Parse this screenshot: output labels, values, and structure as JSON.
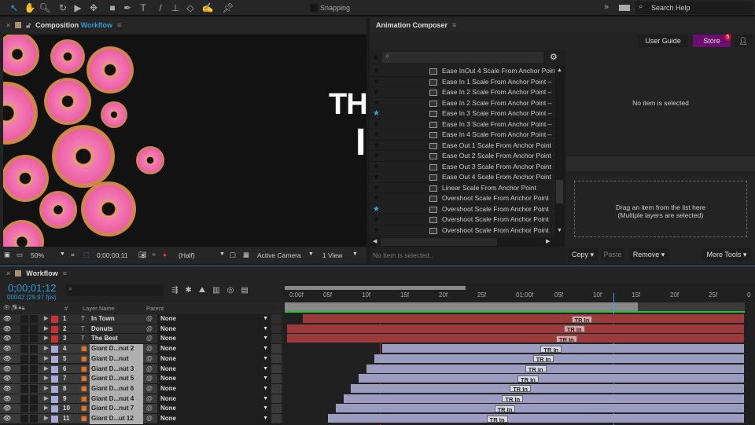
{
  "toolbar": {
    "tools": [
      "selection-tool",
      "hand-tool",
      "zoom-tool",
      "rotate-tool",
      "camera-tool",
      "pan-behind-tool",
      "rectangle-tool",
      "pen-tool",
      "type-tool",
      "brush-tool",
      "clone-stamp-tool",
      "eraser-tool",
      "roto-brush-tool",
      "puppet-pin-tool"
    ],
    "snapping": "Snapping",
    "search_help": "Search Help"
  },
  "composition": {
    "label": "Composition",
    "name": "Workflow",
    "visible_text": [
      "TH",
      "I"
    ],
    "footer": {
      "zoom": "50%",
      "timecode": "0;00;00;11",
      "resolution": "(Half)",
      "camera": "Active Camera",
      "views": "1 View"
    }
  },
  "composer": {
    "title": "Animation Composer",
    "user_guide": "User Guide",
    "store": "Store",
    "store_badge": "5",
    "search_placeholder": "",
    "items": [
      {
        "label": "Ease InOut 4 Scale From Anchor Point",
        "fav": false
      },
      {
        "label": "Ease In 1 Scale From Anchor Point –",
        "fav": false
      },
      {
        "label": "Ease In 2 Scale From Anchor Point –",
        "fav": false
      },
      {
        "label": "Ease In 2 Scale From Anchor Point –",
        "fav": false
      },
      {
        "label": "Ease In 3 Scale From Anchor Point –",
        "fav": true
      },
      {
        "label": "Ease In 3 Scale From Anchor Point –",
        "fav": false
      },
      {
        "label": "Ease In 4 Scale From Anchor Point –",
        "fav": false
      },
      {
        "label": "Ease Out 1 Scale From Anchor Point",
        "fav": false
      },
      {
        "label": "Ease Out 2 Scale From Anchor Point",
        "fav": false
      },
      {
        "label": "Ease Out 3 Scale From Anchor Point",
        "fav": false
      },
      {
        "label": "Ease Out 4 Scale From Anchor Point",
        "fav": false
      },
      {
        "label": "Linear Scale From Anchor Point",
        "fav": false
      },
      {
        "label": "Overshoot Scale From Anchor Point",
        "fav": false
      },
      {
        "label": "Overshoot Scale From Anchor Point",
        "fav": true
      },
      {
        "label": "Overshoot Scale From Anchor Point",
        "fav": false
      },
      {
        "label": "Overshoot Scale From Anchor Point",
        "fav": false
      }
    ],
    "status": "No item is selected..",
    "preview_empty": "No item is selected",
    "drop_line1": "Drag an item from the list here",
    "drop_line2": "(Multiple layers are selected)",
    "copy": "Copy",
    "paste": "Paste",
    "remove": "Remove",
    "more_tools": "More Tools"
  },
  "timeline": {
    "name": "Workflow",
    "timecode": "0;00;01;12",
    "frames": "00042 (29.97 fps)",
    "col_layer": "Layer Name",
    "col_parent": "Parent",
    "col_num": "#",
    "ruler": [
      "0:00f",
      "05f",
      "10f",
      "15f",
      "20f",
      "25f",
      "01:00f",
      "05f",
      "10f",
      "15f",
      "20f",
      "25f",
      "0"
    ],
    "current_frame": 42,
    "work_area_end_frame": 45,
    "layers": [
      {
        "n": "1",
        "name": "In Town",
        "type": "text",
        "color": "#c83232",
        "parent": "None",
        "start": 2,
        "marker": 37,
        "marker_label": "TR In"
      },
      {
        "n": "2",
        "name": "Donuts",
        "type": "text",
        "color": "#c83232",
        "parent": "None",
        "start": 0,
        "marker": 36,
        "marker_label": "TR In"
      },
      {
        "n": "3",
        "name": "The Best",
        "type": "text",
        "color": "#c83232",
        "parent": "None",
        "start": 0,
        "marker": 35,
        "marker_label": "TR In"
      },
      {
        "n": "4",
        "name": "Giant D...nut 2",
        "type": "ai",
        "color": "#a8a8d8",
        "parent": "None",
        "start": 12,
        "marker": 33,
        "marker_label": "TR In"
      },
      {
        "n": "5",
        "name": "Giant D...nut",
        "type": "ai",
        "color": "#a8a8d8",
        "parent": "None",
        "start": 11,
        "marker": 32,
        "marker_label": "TR In"
      },
      {
        "n": "6",
        "name": "Giant D...nut 3",
        "type": "ai",
        "color": "#a8a8d8",
        "parent": "None",
        "start": 10,
        "marker": 31,
        "marker_label": "TR In"
      },
      {
        "n": "7",
        "name": "Giant D...nut 5",
        "type": "ai",
        "color": "#a8a8d8",
        "parent": "None",
        "start": 9,
        "marker": 30,
        "marker_label": "TR In"
      },
      {
        "n": "8",
        "name": "Giant D...nut 6",
        "type": "ai",
        "color": "#a8a8d8",
        "parent": "None",
        "start": 8,
        "marker": 29,
        "marker_label": "TR In"
      },
      {
        "n": "9",
        "name": "Giant D...nut 4",
        "type": "ai",
        "color": "#a8a8d8",
        "parent": "None",
        "start": 7,
        "marker": 28,
        "marker_label": "TR In"
      },
      {
        "n": "10",
        "name": "Giant D...nut 7",
        "type": "ai",
        "color": "#a8a8d8",
        "parent": "None",
        "start": 6,
        "marker": 27,
        "marker_label": "TR In"
      },
      {
        "n": "11",
        "name": "Giant D...ut 12",
        "type": "ai",
        "color": "#a8a8d8",
        "parent": "None",
        "start": 5,
        "marker": 26,
        "marker_label": "TR In"
      }
    ]
  },
  "colors": {
    "accent": "#2d9bd8",
    "store": "#6a0f6e",
    "badge": "#c8102e",
    "red_layer": "#9a3a3a",
    "purple_layer": "#9c9cc0",
    "work_area": "#2ec02e"
  }
}
